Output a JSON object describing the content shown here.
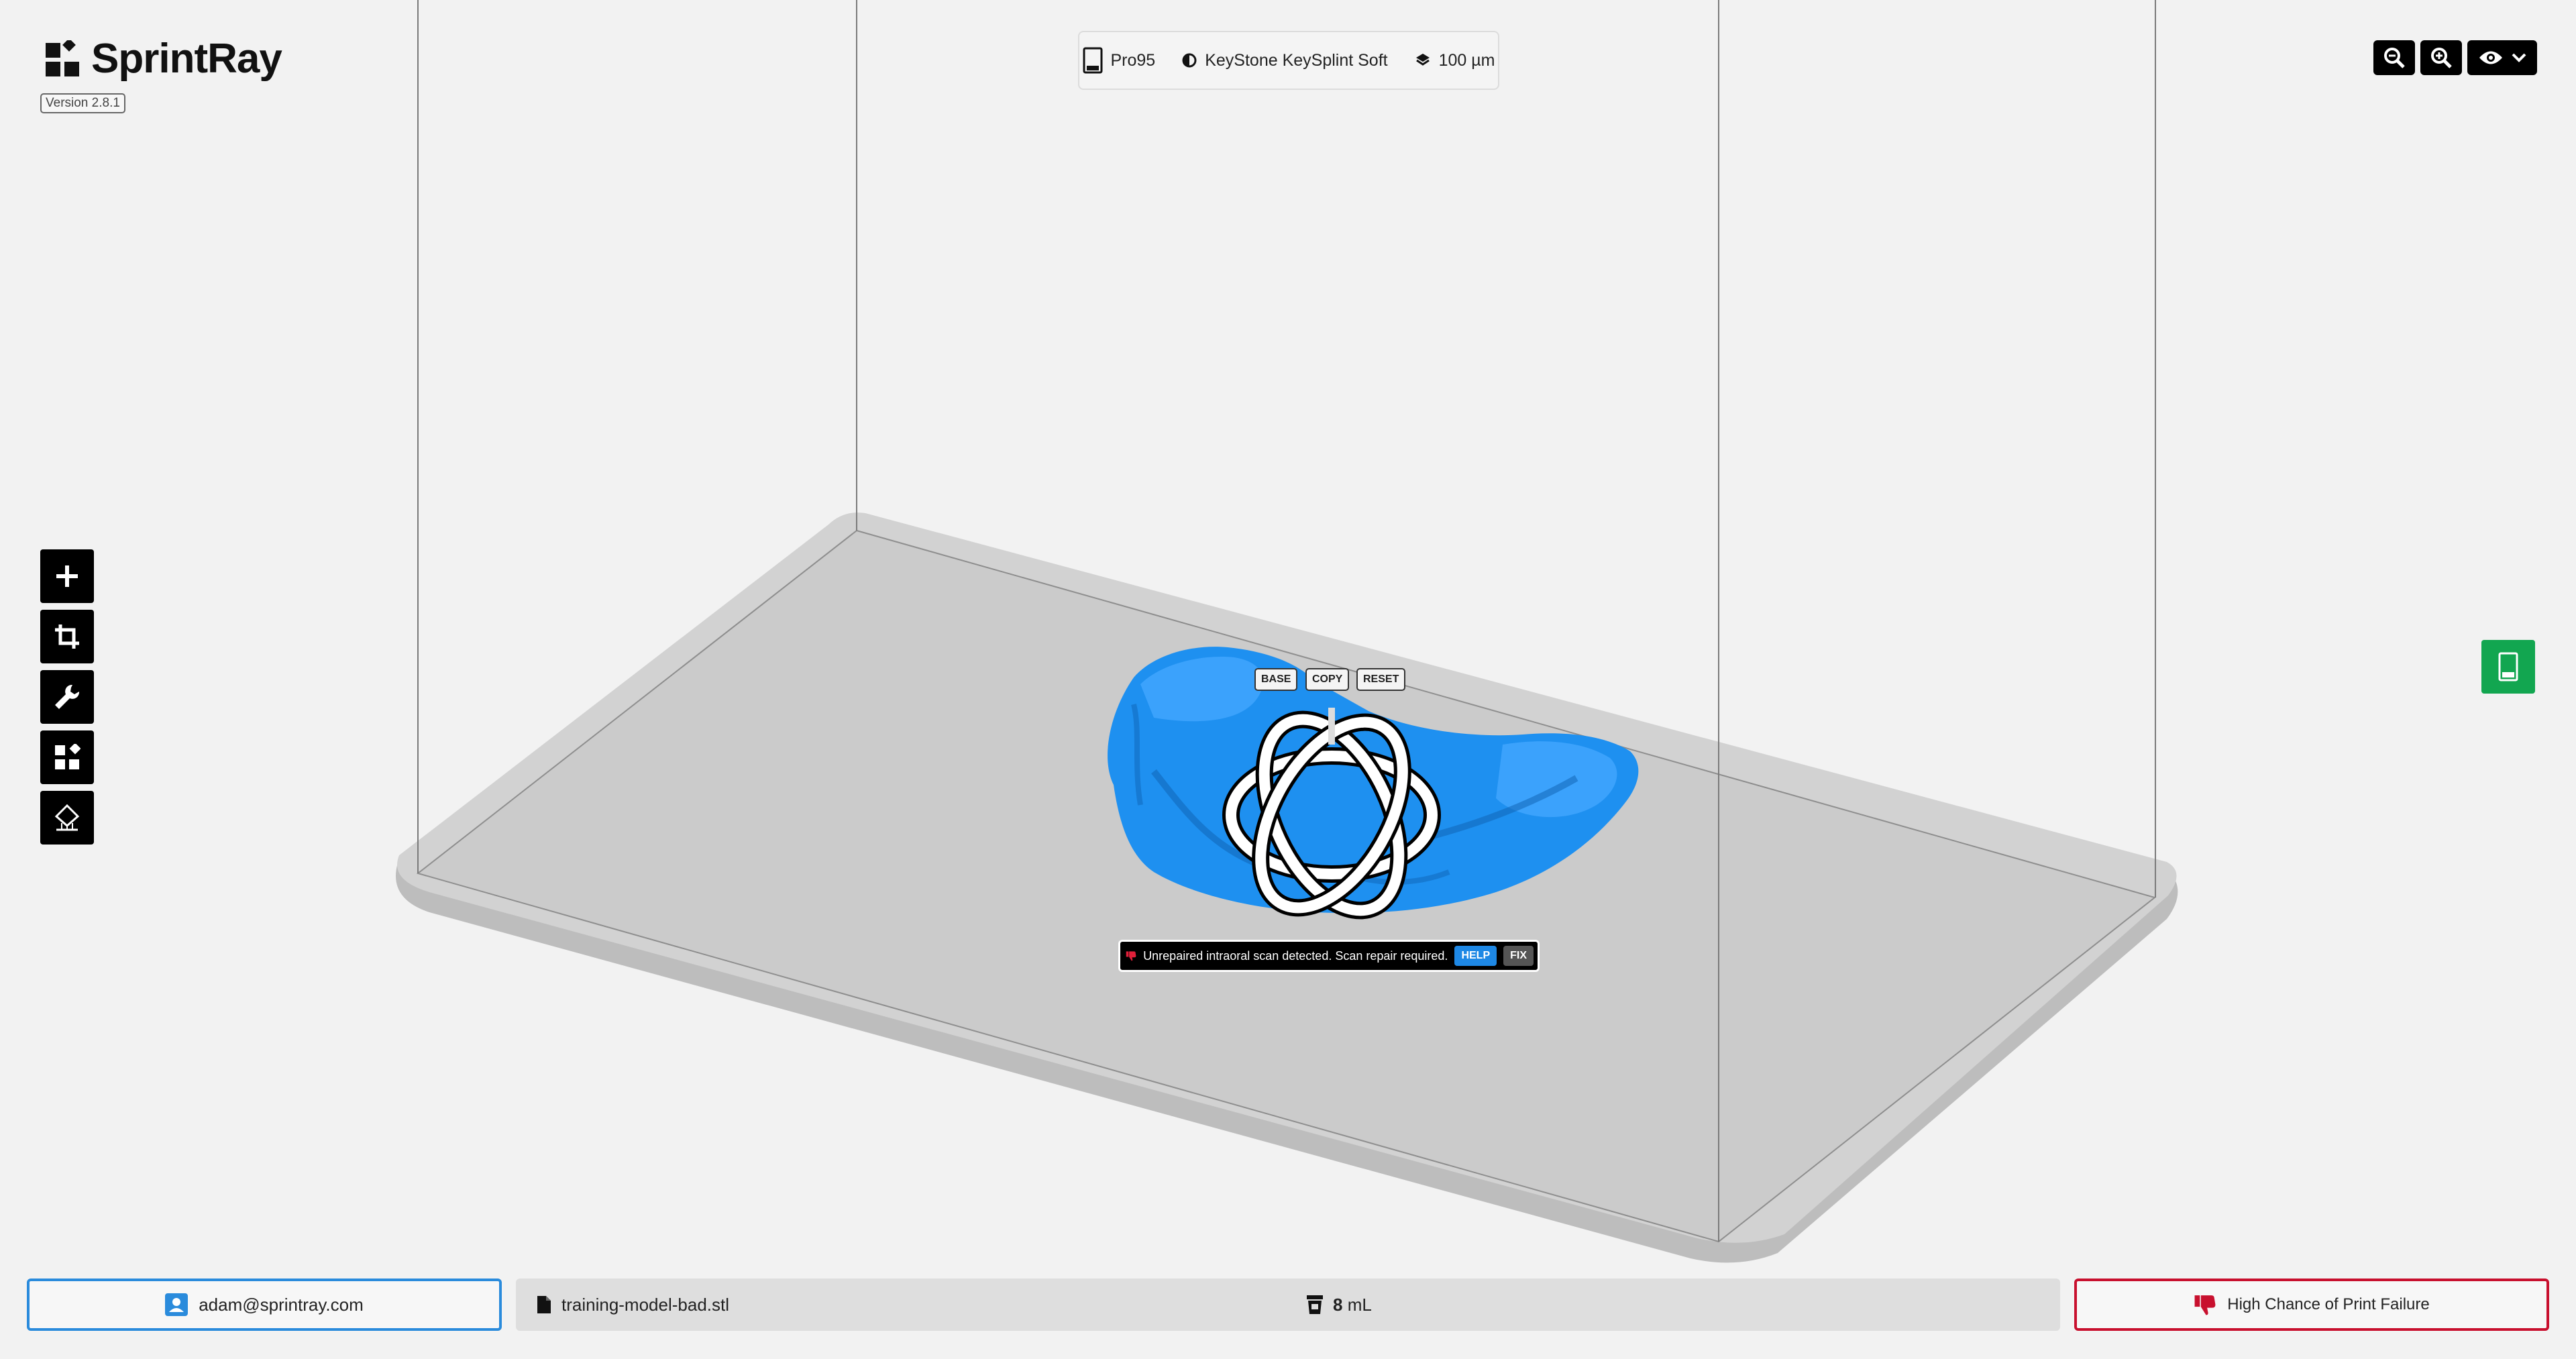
{
  "app": {
    "brand": "SprintRay",
    "version": "Version 2.8.1"
  },
  "printer": {
    "model": "Pro95",
    "resin": "KeyStone KeySplint Soft",
    "layer": "100 µm"
  },
  "model_actions": {
    "base": "BASE",
    "copy": "COPY",
    "reset": "RESET"
  },
  "warning": {
    "message": "Unrepaired intraoral scan detected. Scan repair required.",
    "help": "HELP",
    "fix": "FIX"
  },
  "footer": {
    "user": "adam@sprintray.com",
    "file": "training-model-bad.stl",
    "resin_volume_value": "8",
    "resin_volume_unit": "mL",
    "status": "High Chance of Print Failure"
  },
  "toolbar": {
    "tools": [
      "add-icon",
      "crop-icon",
      "wrench-icon",
      "layout-icon",
      "support-icon"
    ]
  },
  "colors": {
    "accent_blue": "#2a8bdc",
    "model_blue": "#1e90f0",
    "danger_red": "#c8102e",
    "print_green": "#12a650"
  }
}
